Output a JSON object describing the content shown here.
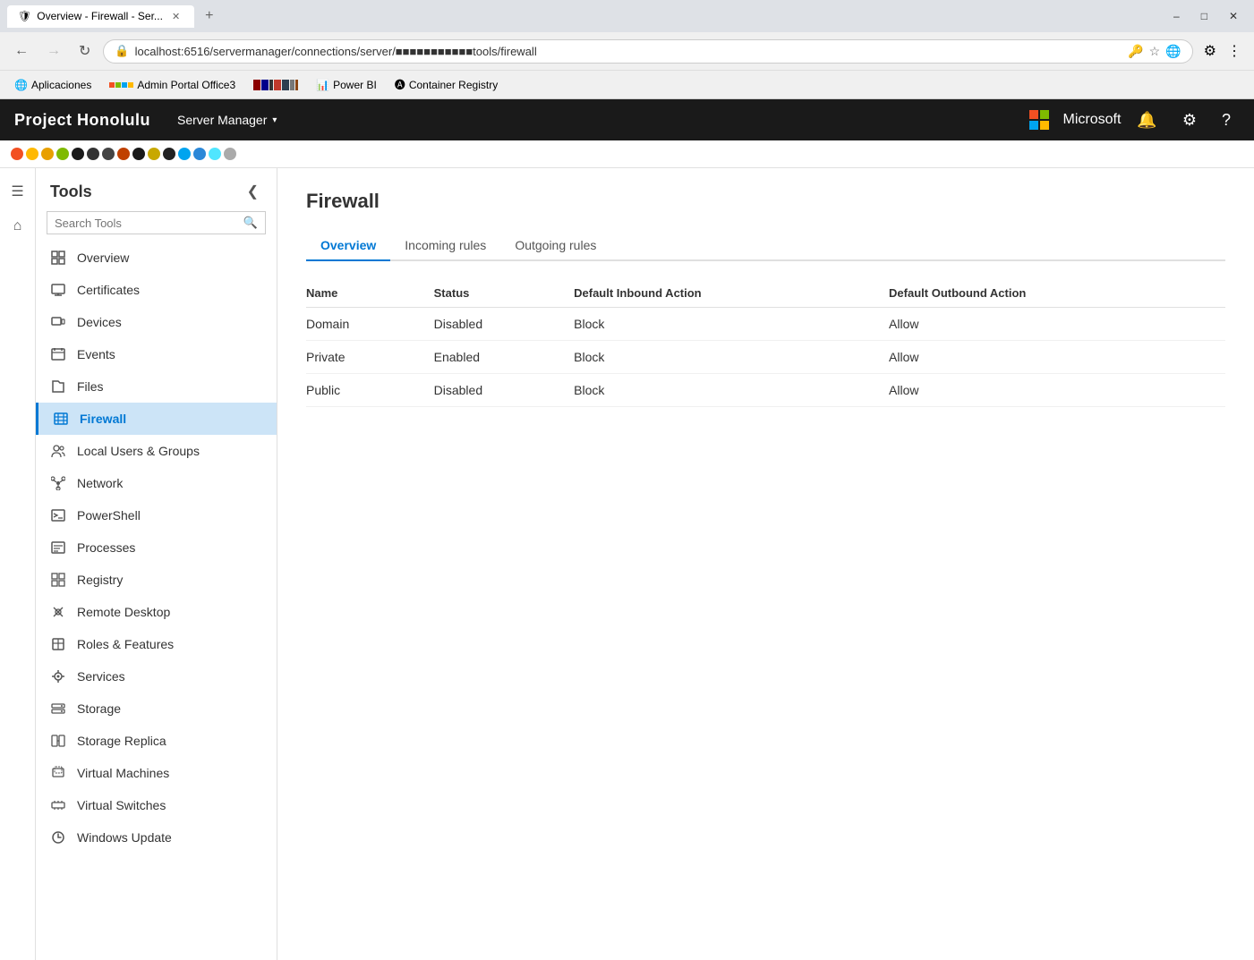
{
  "browser": {
    "tab_title": "Overview - Firewall - Ser...",
    "tab_favicon": "🛡",
    "url": "localhost:6516/servermanager/connections/server/■■■■■■■■■■■tools/firewall",
    "window_controls": [
      "–",
      "□",
      "✕"
    ],
    "bookmarks": [
      {
        "label": "Aplicaciones",
        "icon": "🌐"
      },
      {
        "label": "Admin Portal Office3",
        "icon": "🏢"
      },
      {
        "label": "",
        "icon": "🟥"
      },
      {
        "label": "",
        "icon": "🟦"
      },
      {
        "label": "",
        "icon": "📊"
      },
      {
        "label": "Power BI",
        "icon": "⚡"
      },
      {
        "label": "Container Registry",
        "icon": "📦"
      }
    ]
  },
  "app": {
    "logo": "Project Honolulu",
    "manager": "Server Manager",
    "ms_logo_colors": [
      "#f25022",
      "#7fba00",
      "#00a4ef",
      "#ffb900"
    ],
    "ms_name": "Microsoft",
    "topnav_icons": [
      "🔔",
      "⚙",
      "?"
    ]
  },
  "color_stripe": [
    "#f25022",
    "#ffb900",
    "#e8a000",
    "#7fba00",
    "#000000",
    "#1a1a1a",
    "#333333",
    "#d4580a",
    "#000000",
    "#c8a800",
    "#000000",
    "#00a4ef",
    "#2b88d8",
    "#50e6ff",
    "#888888"
  ],
  "tools": {
    "title": "Tools",
    "search_placeholder": "Search Tools",
    "items": [
      {
        "id": "overview",
        "label": "Overview",
        "icon": "overview"
      },
      {
        "id": "certificates",
        "label": "Certificates",
        "icon": "certificates"
      },
      {
        "id": "devices",
        "label": "Devices",
        "icon": "devices"
      },
      {
        "id": "events",
        "label": "Events",
        "icon": "events"
      },
      {
        "id": "files",
        "label": "Files",
        "icon": "files"
      },
      {
        "id": "firewall",
        "label": "Firewall",
        "icon": "firewall",
        "active": true
      },
      {
        "id": "local-users-groups",
        "label": "Local Users & Groups",
        "icon": "users"
      },
      {
        "id": "network",
        "label": "Network",
        "icon": "network"
      },
      {
        "id": "powershell",
        "label": "PowerShell",
        "icon": "powershell"
      },
      {
        "id": "processes",
        "label": "Processes",
        "icon": "processes"
      },
      {
        "id": "registry",
        "label": "Registry",
        "icon": "registry"
      },
      {
        "id": "remote-desktop",
        "label": "Remote Desktop",
        "icon": "remote-desktop"
      },
      {
        "id": "roles-features",
        "label": "Roles & Features",
        "icon": "roles"
      },
      {
        "id": "services",
        "label": "Services",
        "icon": "services"
      },
      {
        "id": "storage",
        "label": "Storage",
        "icon": "storage"
      },
      {
        "id": "storage-replica",
        "label": "Storage Replica",
        "icon": "storage-replica"
      },
      {
        "id": "virtual-machines",
        "label": "Virtual Machines",
        "icon": "virtual-machines"
      },
      {
        "id": "virtual-switches",
        "label": "Virtual Switches",
        "icon": "virtual-switches"
      },
      {
        "id": "windows-update",
        "label": "Windows Update",
        "icon": "windows-update"
      }
    ]
  },
  "firewall": {
    "title": "Firewall",
    "tabs": [
      {
        "id": "overview",
        "label": "Overview",
        "active": true
      },
      {
        "id": "incoming",
        "label": "Incoming rules",
        "active": false
      },
      {
        "id": "outgoing",
        "label": "Outgoing rules",
        "active": false
      }
    ],
    "table_headers": [
      "Name",
      "Status",
      "Default Inbound Action",
      "Default Outbound Action"
    ],
    "rows": [
      {
        "name": "Domain",
        "status": "Disabled",
        "inbound": "Block",
        "outbound": "Allow"
      },
      {
        "name": "Private",
        "status": "Enabled",
        "inbound": "Block",
        "outbound": "Allow"
      },
      {
        "name": "Public",
        "status": "Disabled",
        "inbound": "Block",
        "outbound": "Allow"
      }
    ]
  }
}
